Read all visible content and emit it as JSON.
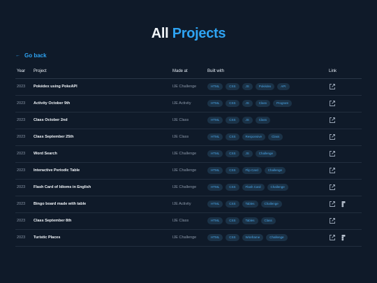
{
  "title": {
    "part1": "All",
    "part2": "Projects"
  },
  "nav": {
    "arrow": "←",
    "go_back_label": "Go back"
  },
  "table": {
    "headers": {
      "year": "Year",
      "project": "Project",
      "made_at": "Made at",
      "built_with": "Built with",
      "link": "Link"
    },
    "rows": [
      {
        "year": "2023",
        "project": "Pokédex using PokeAPI",
        "made_at": "IJE Challenge",
        "tags": [
          "HTML",
          "CSS",
          "JS",
          "Pokédex",
          "API"
        ],
        "figma": false
      },
      {
        "year": "2023",
        "project": "Activity October 9th",
        "made_at": "IJE Activity",
        "tags": [
          "HTML",
          "CSS",
          "JS",
          "Class",
          "Program"
        ],
        "figma": false
      },
      {
        "year": "2023",
        "project": "Class October 2nd",
        "made_at": "IJE Class",
        "tags": [
          "HTML",
          "CSS",
          "JS",
          "Class"
        ],
        "figma": false
      },
      {
        "year": "2023",
        "project": "Class September 25th",
        "made_at": "IJE Class",
        "tags": [
          "HTML",
          "CSS",
          "Responsive",
          "Class"
        ],
        "figma": false
      },
      {
        "year": "2023",
        "project": "Word Search",
        "made_at": "IJE Challenge",
        "tags": [
          "HTML",
          "CSS",
          "JS",
          "Challenge"
        ],
        "figma": false
      },
      {
        "year": "2023",
        "project": "Interactive Periodic Table",
        "made_at": "IJE Challenge",
        "tags": [
          "HTML",
          "CSS",
          "Flip Card",
          "Challenge"
        ],
        "figma": false
      },
      {
        "year": "2023",
        "project": "Flash Card of Idioms in English",
        "made_at": "IJE Challenge",
        "tags": [
          "HTML",
          "CSS",
          "Flash Card",
          "Challenge"
        ],
        "figma": false
      },
      {
        "year": "2023",
        "project": "Bingo board made with table",
        "made_at": "IJE Activity",
        "tags": [
          "HTML",
          "CSS",
          "Tables",
          "Challenge"
        ],
        "figma": true
      },
      {
        "year": "2023",
        "project": "Class September 8th",
        "made_at": "IJE Class",
        "tags": [
          "HTML",
          "CSS",
          "Tables",
          "Class"
        ],
        "figma": false
      },
      {
        "year": "2023",
        "project": "Turistic Places",
        "made_at": "IJE Challenge",
        "tags": [
          "HTML",
          "CSS",
          "Wireframe",
          "Challenge"
        ],
        "figma": true
      }
    ]
  },
  "icons": {
    "external": "external-link-icon",
    "figma": "figma-icon"
  },
  "colors": {
    "background": "#0f1a29",
    "accent": "#2ea3f2",
    "tag_bg": "#1b3247",
    "tag_text": "#4aa6e8"
  }
}
